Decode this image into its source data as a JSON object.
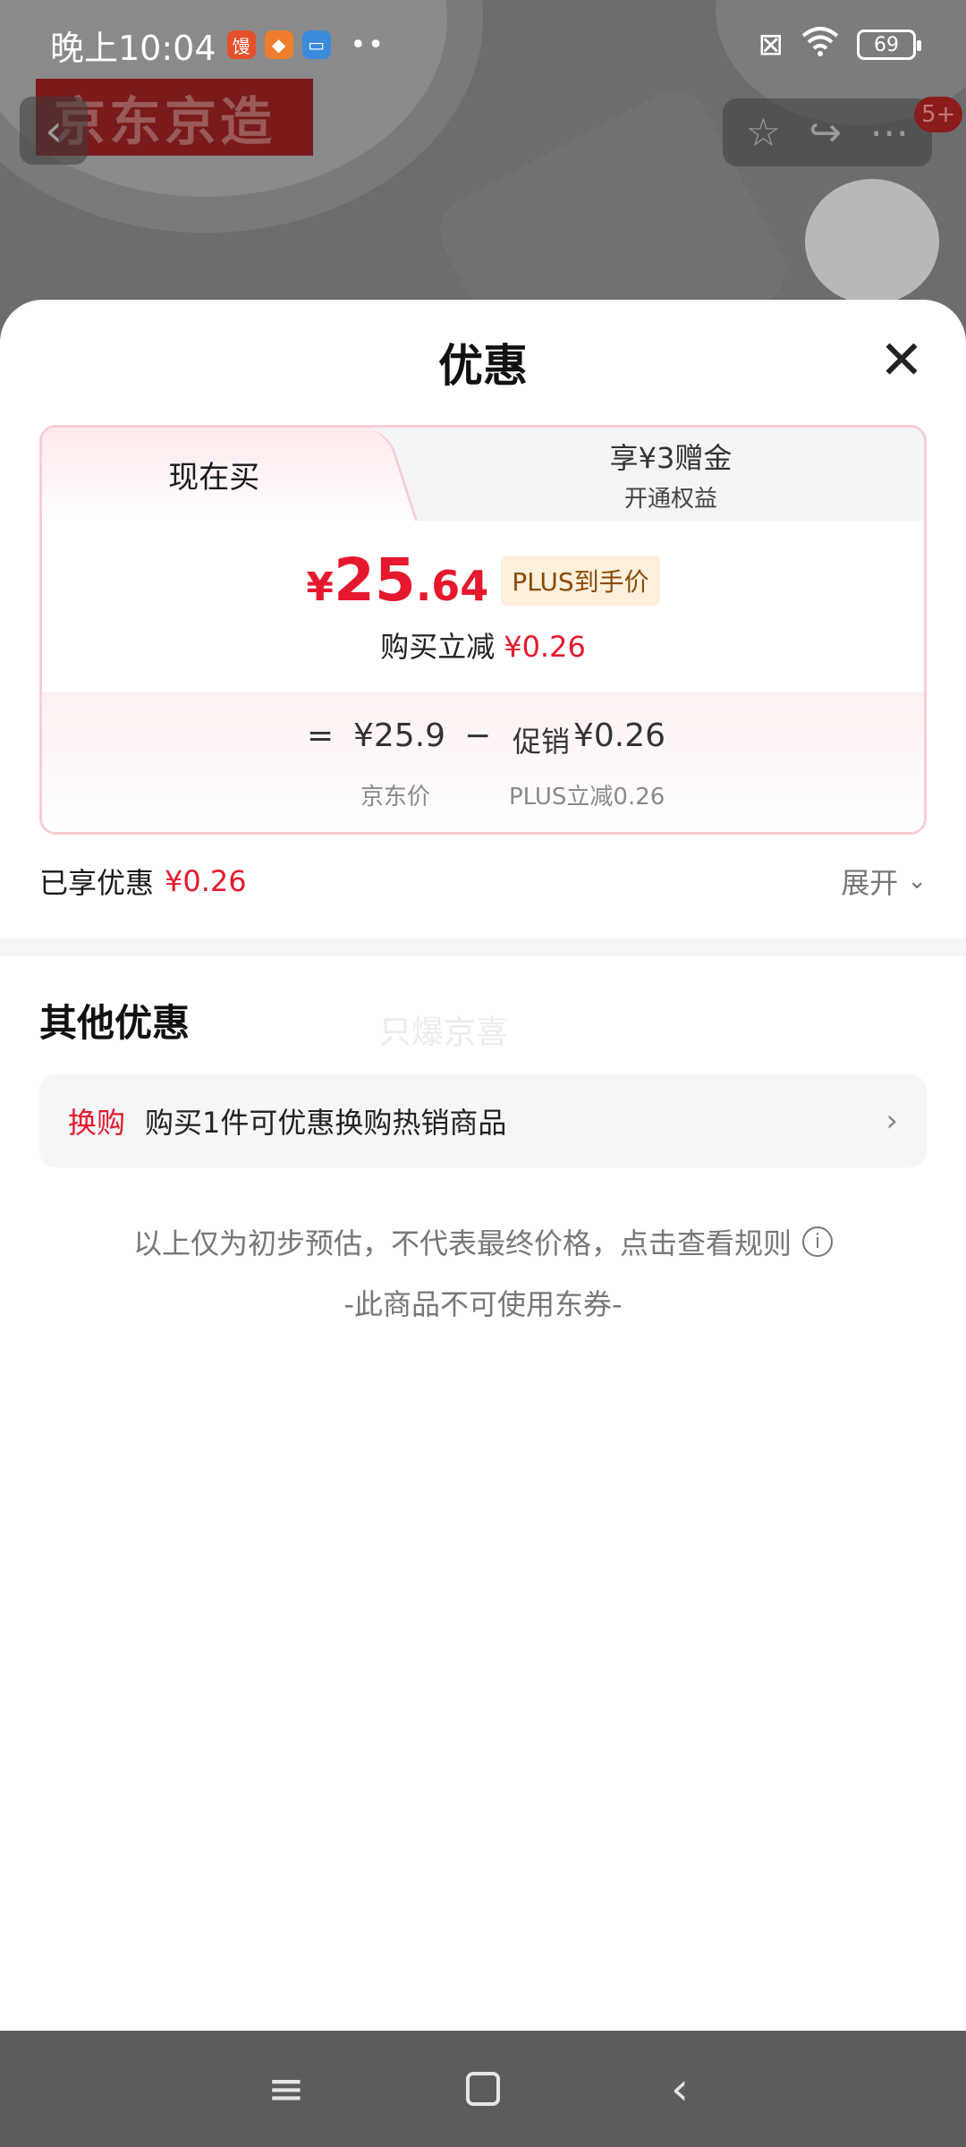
{
  "status_bar": {
    "time": "晚上10:04",
    "app_icon_1_text": "馒",
    "dots": "••",
    "battery_level": "69"
  },
  "background_page": {
    "brand_badge": "京东京造",
    "notification_count": "5+"
  },
  "sheet": {
    "title": "优惠",
    "tabs": {
      "active_label": "现在买",
      "inactive_main": "享¥3赠金",
      "inactive_sub": "开通权益"
    },
    "price": {
      "currency": "¥",
      "integer": "25",
      "decimal": ".64",
      "plus_tag": "PLUS到手价",
      "reduce_label": "购买立减",
      "reduce_value": "¥0.26"
    },
    "calculation": {
      "equals": "=",
      "base_price": "¥25.9",
      "minus": "−",
      "promo_label": "促销",
      "promo_value": "¥0.26",
      "base_label": "京东价",
      "promo_sub_label": "PLUS立减0.26"
    },
    "enjoyed": {
      "label": "已享优惠",
      "value": "¥0.26",
      "expand_label": "展开"
    },
    "other": {
      "title": "其他优惠",
      "watermark": "只爆京喜",
      "swap_tag": "换购",
      "swap_text": "购买1件可优惠换购热销商品"
    },
    "notice": "以上仅为初步预估，不代表最终价格，点击查看规则",
    "coupon_note": "-此商品不可使用东券-"
  },
  "colors": {
    "accent_red": "#e6182d",
    "tag_bg": "#fdf0dc",
    "tag_text": "#8a4a07",
    "card_border": "#f7cdd3"
  }
}
